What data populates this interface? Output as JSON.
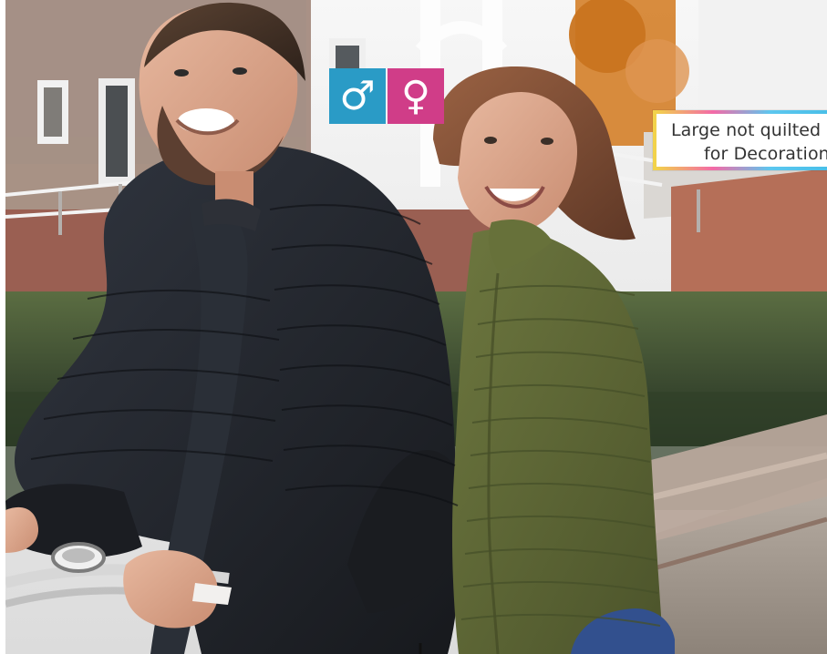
{
  "badges": {
    "male_symbol": "♂",
    "female_symbol": "♀",
    "male_color": "#2a9bc6",
    "female_color": "#d03d88"
  },
  "label": {
    "line1": "Large not quilted",
    "line2": "for Decoration"
  },
  "photo": {
    "scene": "outdoor bridge and canal",
    "colors": {
      "sky": "#efefef",
      "brick": "#8d5f4c",
      "water": "#30412d",
      "jacket_black": "#1f2228",
      "jacket_green": "#5c6534",
      "skin": "#d8a385",
      "hair_brown": "#7a4b32",
      "hair_dark": "#3a2a22",
      "foliage": "#d57b2a",
      "rail": "#d9d9d9"
    }
  }
}
